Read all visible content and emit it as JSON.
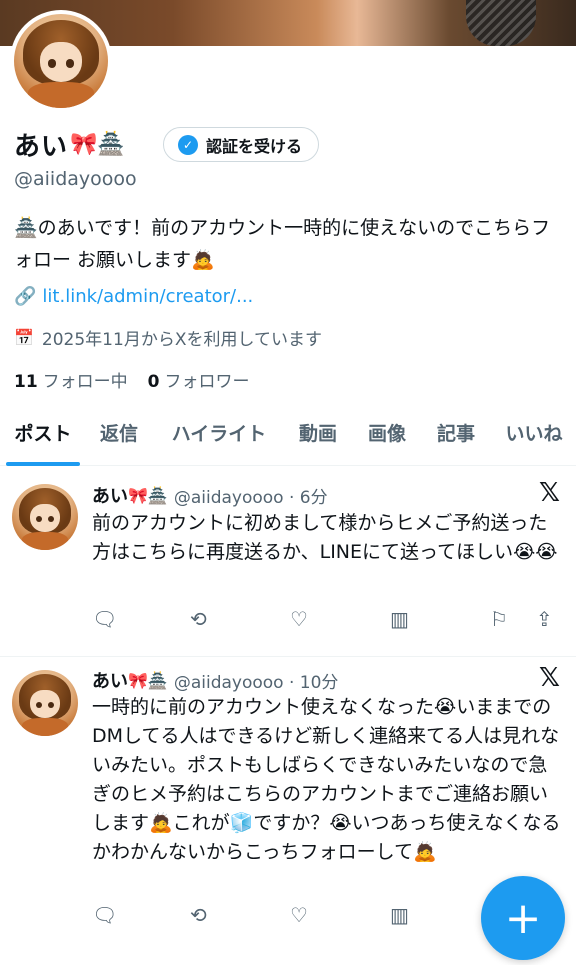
{
  "profile": {
    "name": "あい",
    "name_emojis": "🎀🏯",
    "handle": "@aiidayoooo",
    "verify_button": "認証を受ける",
    "bio": "🏯のあいです！前のアカウント一時的に使えないのでこちらフォロー お願いします🙇",
    "link": "lit.link/admin/creator/...",
    "joined": "2025年11月からXを利用しています",
    "following_count": "11",
    "following_label": "フォロー中",
    "followers_count": "0",
    "followers_label": "フォロワー"
  },
  "tabs": [
    "ポスト",
    "返信",
    "ハイライト",
    "動画",
    "画像",
    "記事",
    "いいね"
  ],
  "posts": [
    {
      "name": "あい",
      "emojis": "🎀🏯",
      "meta": "@aiidayoooo · 6分",
      "text": "前のアカウントに初めまして様からヒメご予約送った方はこちらに再度送るか、LINEにて送ってほしい😭😭"
    },
    {
      "name": "あい",
      "emojis": "🎀🏯",
      "meta": "@aiidayoooo · 10分",
      "text": "一時的に前のアカウント使えなくなった😭いままでのDMしてる人はできるけど新しく連絡来てる人は見れないみたい。ポストもしばらくできないみたいなので急ぎのヒメ予約はこちらのアカウントまでご連絡お願いします🙇これが🧊ですか？😭いつあっち使えなくなるかわかんないからこっちフォローして🙇"
    }
  ],
  "icons": {
    "link": "link-icon",
    "calendar": "calendar-icon",
    "verified": "verified-badge-icon",
    "x_logo": "x-logo-icon",
    "reply": "reply-icon",
    "repost": "repost-icon",
    "like": "heart-icon",
    "views": "views-icon",
    "bookmark": "bookmark-icon",
    "share": "share-icon",
    "compose": "plus-icon"
  },
  "colors": {
    "accent": "#1d9bf0",
    "text": "#0f1419",
    "secondary": "#536471"
  }
}
